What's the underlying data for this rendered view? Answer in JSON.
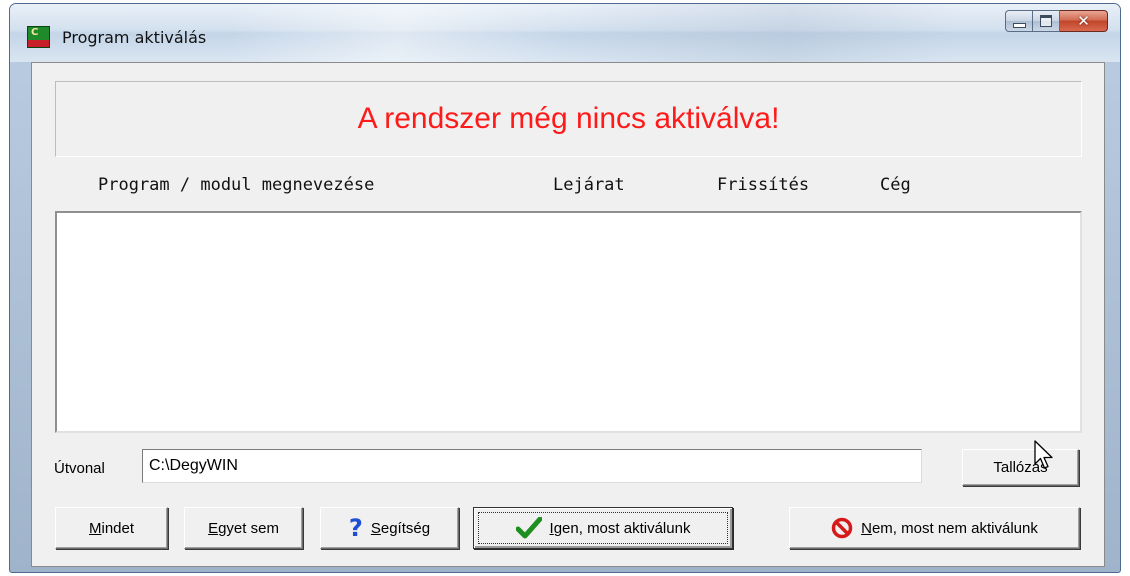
{
  "window": {
    "title": "Program aktiválás",
    "controls": {
      "minimize": "minimize-icon",
      "maximize": "maximize-icon",
      "close": "close-icon"
    }
  },
  "banner": {
    "message": "A rendszer még nincs aktiválva!",
    "color": "#ff1a1a"
  },
  "columns": [
    "Program / modul megnevezése",
    "Lejárat",
    "Frissítés",
    "Cég"
  ],
  "list": {
    "rows": []
  },
  "path": {
    "label": "Útvonal",
    "value": "C:\\DegyWIN"
  },
  "buttons": {
    "browse": "Tallózás",
    "all": {
      "accel": "M",
      "rest": "indet"
    },
    "none": {
      "accel": "E",
      "rest": "gyet sem"
    },
    "help": {
      "accel": "S",
      "rest": "egítség",
      "icon": "question-icon"
    },
    "yes": {
      "accel": "I",
      "rest": "gen, most aktiválunk",
      "icon": "checkmark-icon"
    },
    "no": {
      "accel": "N",
      "rest": "em, most nem aktiválunk",
      "icon": "no-entry-icon"
    }
  }
}
